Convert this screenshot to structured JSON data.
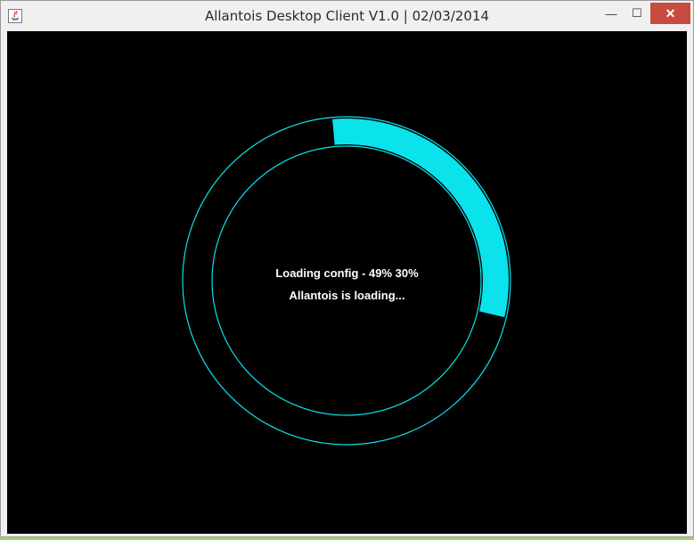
{
  "window": {
    "title": "Allantois Desktop Client V1.0 | 02/03/2014",
    "controls": {
      "minimize": "—",
      "maximize": "☐",
      "close": "✕"
    }
  },
  "loader": {
    "status_text": "Loading config - 49% 30%",
    "message": "Allantois is loading...",
    "progress": 0.3,
    "accent_color": "#0be3ec",
    "background_color": "#000000"
  }
}
